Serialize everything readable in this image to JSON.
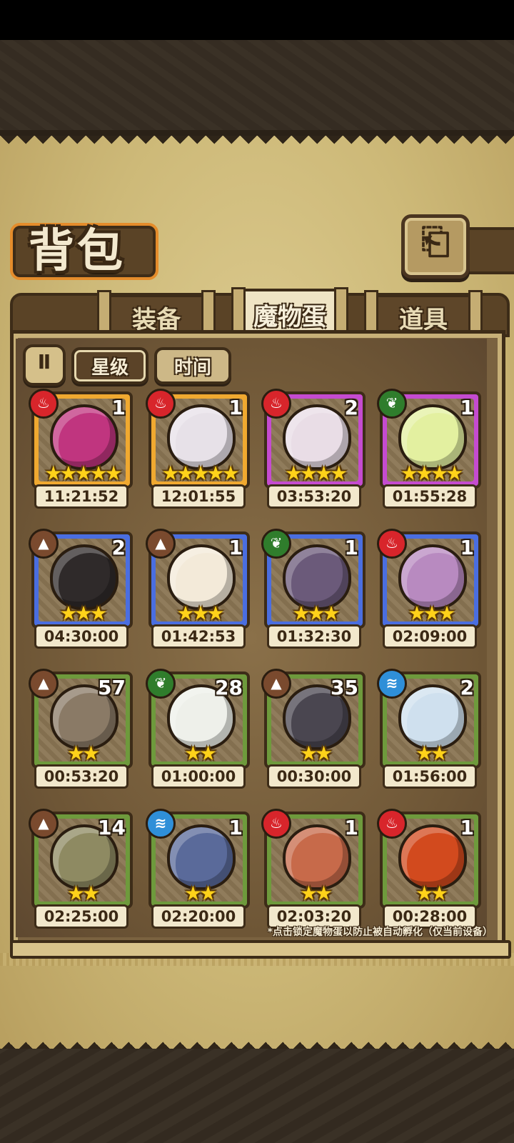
{
  "header": {
    "title": "背包",
    "back_icon": "⎗"
  },
  "tabs": [
    {
      "label": "装备",
      "active": false
    },
    {
      "label": "魔物蛋",
      "active": true
    },
    {
      "label": "道具",
      "active": false
    }
  ],
  "sort": {
    "order_icon": "Ⅱ",
    "options": [
      {
        "label": "星级",
        "active": true
      },
      {
        "label": "时间",
        "active": false
      }
    ]
  },
  "eggs": [
    {
      "element": "fire",
      "count": "1",
      "stars": "★★★★★",
      "timer": "11:21:52",
      "frame": "gold",
      "color": "#c0357f"
    },
    {
      "element": "fire",
      "count": "1",
      "stars": "★★★★★",
      "timer": "12:01:55",
      "frame": "gold",
      "color": "#e7e1e8"
    },
    {
      "element": "fire",
      "count": "2",
      "stars": "★★★★",
      "timer": "03:53:20",
      "frame": "purple",
      "color": "#e9dde6"
    },
    {
      "element": "leaf",
      "count": "1",
      "stars": "★★★★",
      "timer": "01:55:28",
      "frame": "purple",
      "color": "#e3f0a0"
    },
    {
      "element": "earth",
      "count": "2",
      "stars": "★★★",
      "timer": "04:30:00",
      "frame": "blue",
      "color": "#2f2a2a"
    },
    {
      "element": "earth",
      "count": "1",
      "stars": "★★★",
      "timer": "01:42:53",
      "frame": "blue",
      "color": "#f3ead9"
    },
    {
      "element": "leaf",
      "count": "1",
      "stars": "★★★",
      "timer": "01:32:30",
      "frame": "blue",
      "color": "#6b5a7a"
    },
    {
      "element": "fire",
      "count": "1",
      "stars": "★★★",
      "timer": "02:09:00",
      "frame": "blue",
      "color": "#b88ac0"
    },
    {
      "element": "earth",
      "count": "57",
      "stars": "★★",
      "timer": "00:53:20",
      "frame": "green",
      "color": "#8a7a66"
    },
    {
      "element": "leaf",
      "count": "28",
      "stars": "★★",
      "timer": "01:00:00",
      "frame": "green",
      "color": "#eef0ea"
    },
    {
      "element": "earth",
      "count": "35",
      "stars": "★★",
      "timer": "00:30:00",
      "frame": "green",
      "color": "#4a4650"
    },
    {
      "element": "water",
      "count": "2",
      "stars": "★★",
      "timer": "01:56:00",
      "frame": "green",
      "color": "#cfe0ee"
    },
    {
      "element": "earth",
      "count": "14",
      "stars": "★★",
      "timer": "02:25:00",
      "frame": "green",
      "color": "#8e8a62"
    },
    {
      "element": "water",
      "count": "1",
      "stars": "★★",
      "timer": "02:20:00",
      "frame": "green",
      "color": "#5a6a9a"
    },
    {
      "element": "fire",
      "count": "1",
      "stars": "★★",
      "timer": "02:03:20",
      "frame": "green",
      "color": "#c76a4a"
    },
    {
      "element": "fire",
      "count": "1",
      "stars": "★★",
      "timer": "00:28:00",
      "frame": "green",
      "color": "#d24a1e"
    }
  ],
  "footer_note": "*点击锁定魔物蛋以防止被自动孵化（仅当前设备）"
}
